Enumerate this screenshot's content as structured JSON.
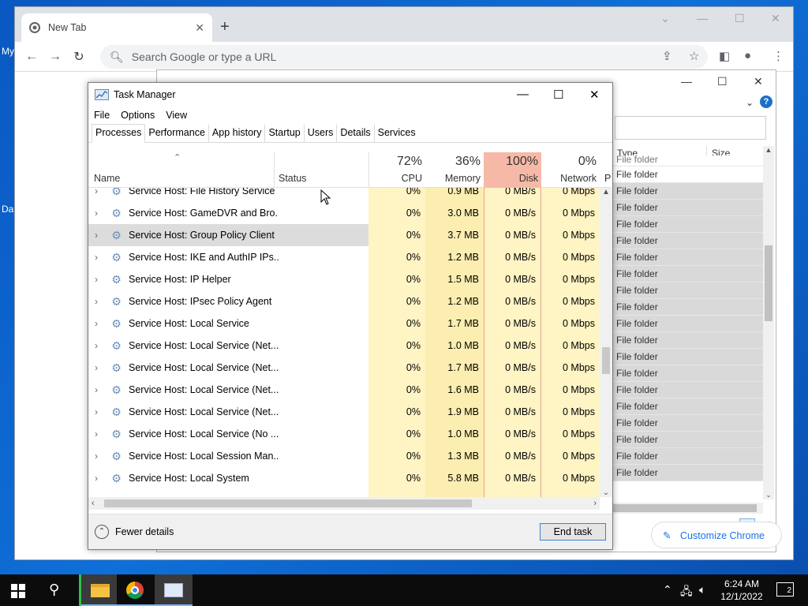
{
  "desktop": {
    "label_my": "My",
    "label_da": "Da"
  },
  "chrome": {
    "tab_title": "New Tab",
    "omnibox_placeholder": "Search Google or type a URL",
    "customize_label": "Customize Chrome"
  },
  "explorer": {
    "col_type": "Type",
    "col_size": "Size",
    "rows": [
      "File folder",
      "File folder",
      "File folder",
      "File folder",
      "File folder",
      "File folder",
      "File folder",
      "File folder",
      "File folder",
      "File folder",
      "File folder",
      "File folder",
      "File folder",
      "File folder",
      "File folder",
      "File folder",
      "File folder",
      "File folder",
      "File folder",
      "File folder"
    ]
  },
  "taskmanager": {
    "title": "Task Manager",
    "menu": [
      "File",
      "Options",
      "View"
    ],
    "tabs": [
      "Processes",
      "Performance",
      "App history",
      "Startup",
      "Users",
      "Details",
      "Services"
    ],
    "header": {
      "name": "Name",
      "status": "Status",
      "cpu_pct": "72%",
      "cpu_label": "CPU",
      "mem_pct": "36%",
      "mem_label": "Memory",
      "disk_pct": "100%",
      "disk_label": "Disk",
      "net_pct": "0%",
      "net_label": "Network",
      "power_label": "P"
    },
    "rows": [
      {
        "name": "Service Host: File History Service",
        "cpu": "0%",
        "mem": "0.9 MB",
        "disk": "0 MB/s",
        "net": "0 Mbps"
      },
      {
        "name": "Service Host: GameDVR and Bro...",
        "cpu": "0%",
        "mem": "3.0 MB",
        "disk": "0 MB/s",
        "net": "0 Mbps"
      },
      {
        "name": "Service Host: Group Policy Client",
        "cpu": "0%",
        "mem": "3.7 MB",
        "disk": "0 MB/s",
        "net": "0 Mbps"
      },
      {
        "name": "Service Host: IKE and AuthIP IPs...",
        "cpu": "0%",
        "mem": "1.2 MB",
        "disk": "0 MB/s",
        "net": "0 Mbps"
      },
      {
        "name": "Service Host: IP Helper",
        "cpu": "0%",
        "mem": "1.5 MB",
        "disk": "0 MB/s",
        "net": "0 Mbps"
      },
      {
        "name": "Service Host: IPsec Policy Agent",
        "cpu": "0%",
        "mem": "1.2 MB",
        "disk": "0 MB/s",
        "net": "0 Mbps"
      },
      {
        "name": "Service Host: Local Service",
        "cpu": "0%",
        "mem": "1.7 MB",
        "disk": "0 MB/s",
        "net": "0 Mbps"
      },
      {
        "name": "Service Host: Local Service (Net...",
        "cpu": "0%",
        "mem": "1.0 MB",
        "disk": "0 MB/s",
        "net": "0 Mbps"
      },
      {
        "name": "Service Host: Local Service (Net...",
        "cpu": "0%",
        "mem": "1.7 MB",
        "disk": "0 MB/s",
        "net": "0 Mbps"
      },
      {
        "name": "Service Host: Local Service (Net...",
        "cpu": "0%",
        "mem": "1.6 MB",
        "disk": "0 MB/s",
        "net": "0 Mbps"
      },
      {
        "name": "Service Host: Local Service (Net...",
        "cpu": "0%",
        "mem": "1.9 MB",
        "disk": "0 MB/s",
        "net": "0 Mbps"
      },
      {
        "name": "Service Host: Local Service (No ...",
        "cpu": "0%",
        "mem": "1.0 MB",
        "disk": "0 MB/s",
        "net": "0 Mbps"
      },
      {
        "name": "Service Host: Local Session Man...",
        "cpu": "0%",
        "mem": "1.3 MB",
        "disk": "0 MB/s",
        "net": "0 Mbps"
      },
      {
        "name": "Service Host: Local System",
        "cpu": "0%",
        "mem": "5.8 MB",
        "disk": "0 MB/s",
        "net": "0 Mbps"
      }
    ],
    "fewer_details": "Fewer details",
    "end_task": "End task"
  },
  "taskbar": {
    "time": "6:24 AM",
    "date": "12/1/2022",
    "notifications": "2"
  }
}
